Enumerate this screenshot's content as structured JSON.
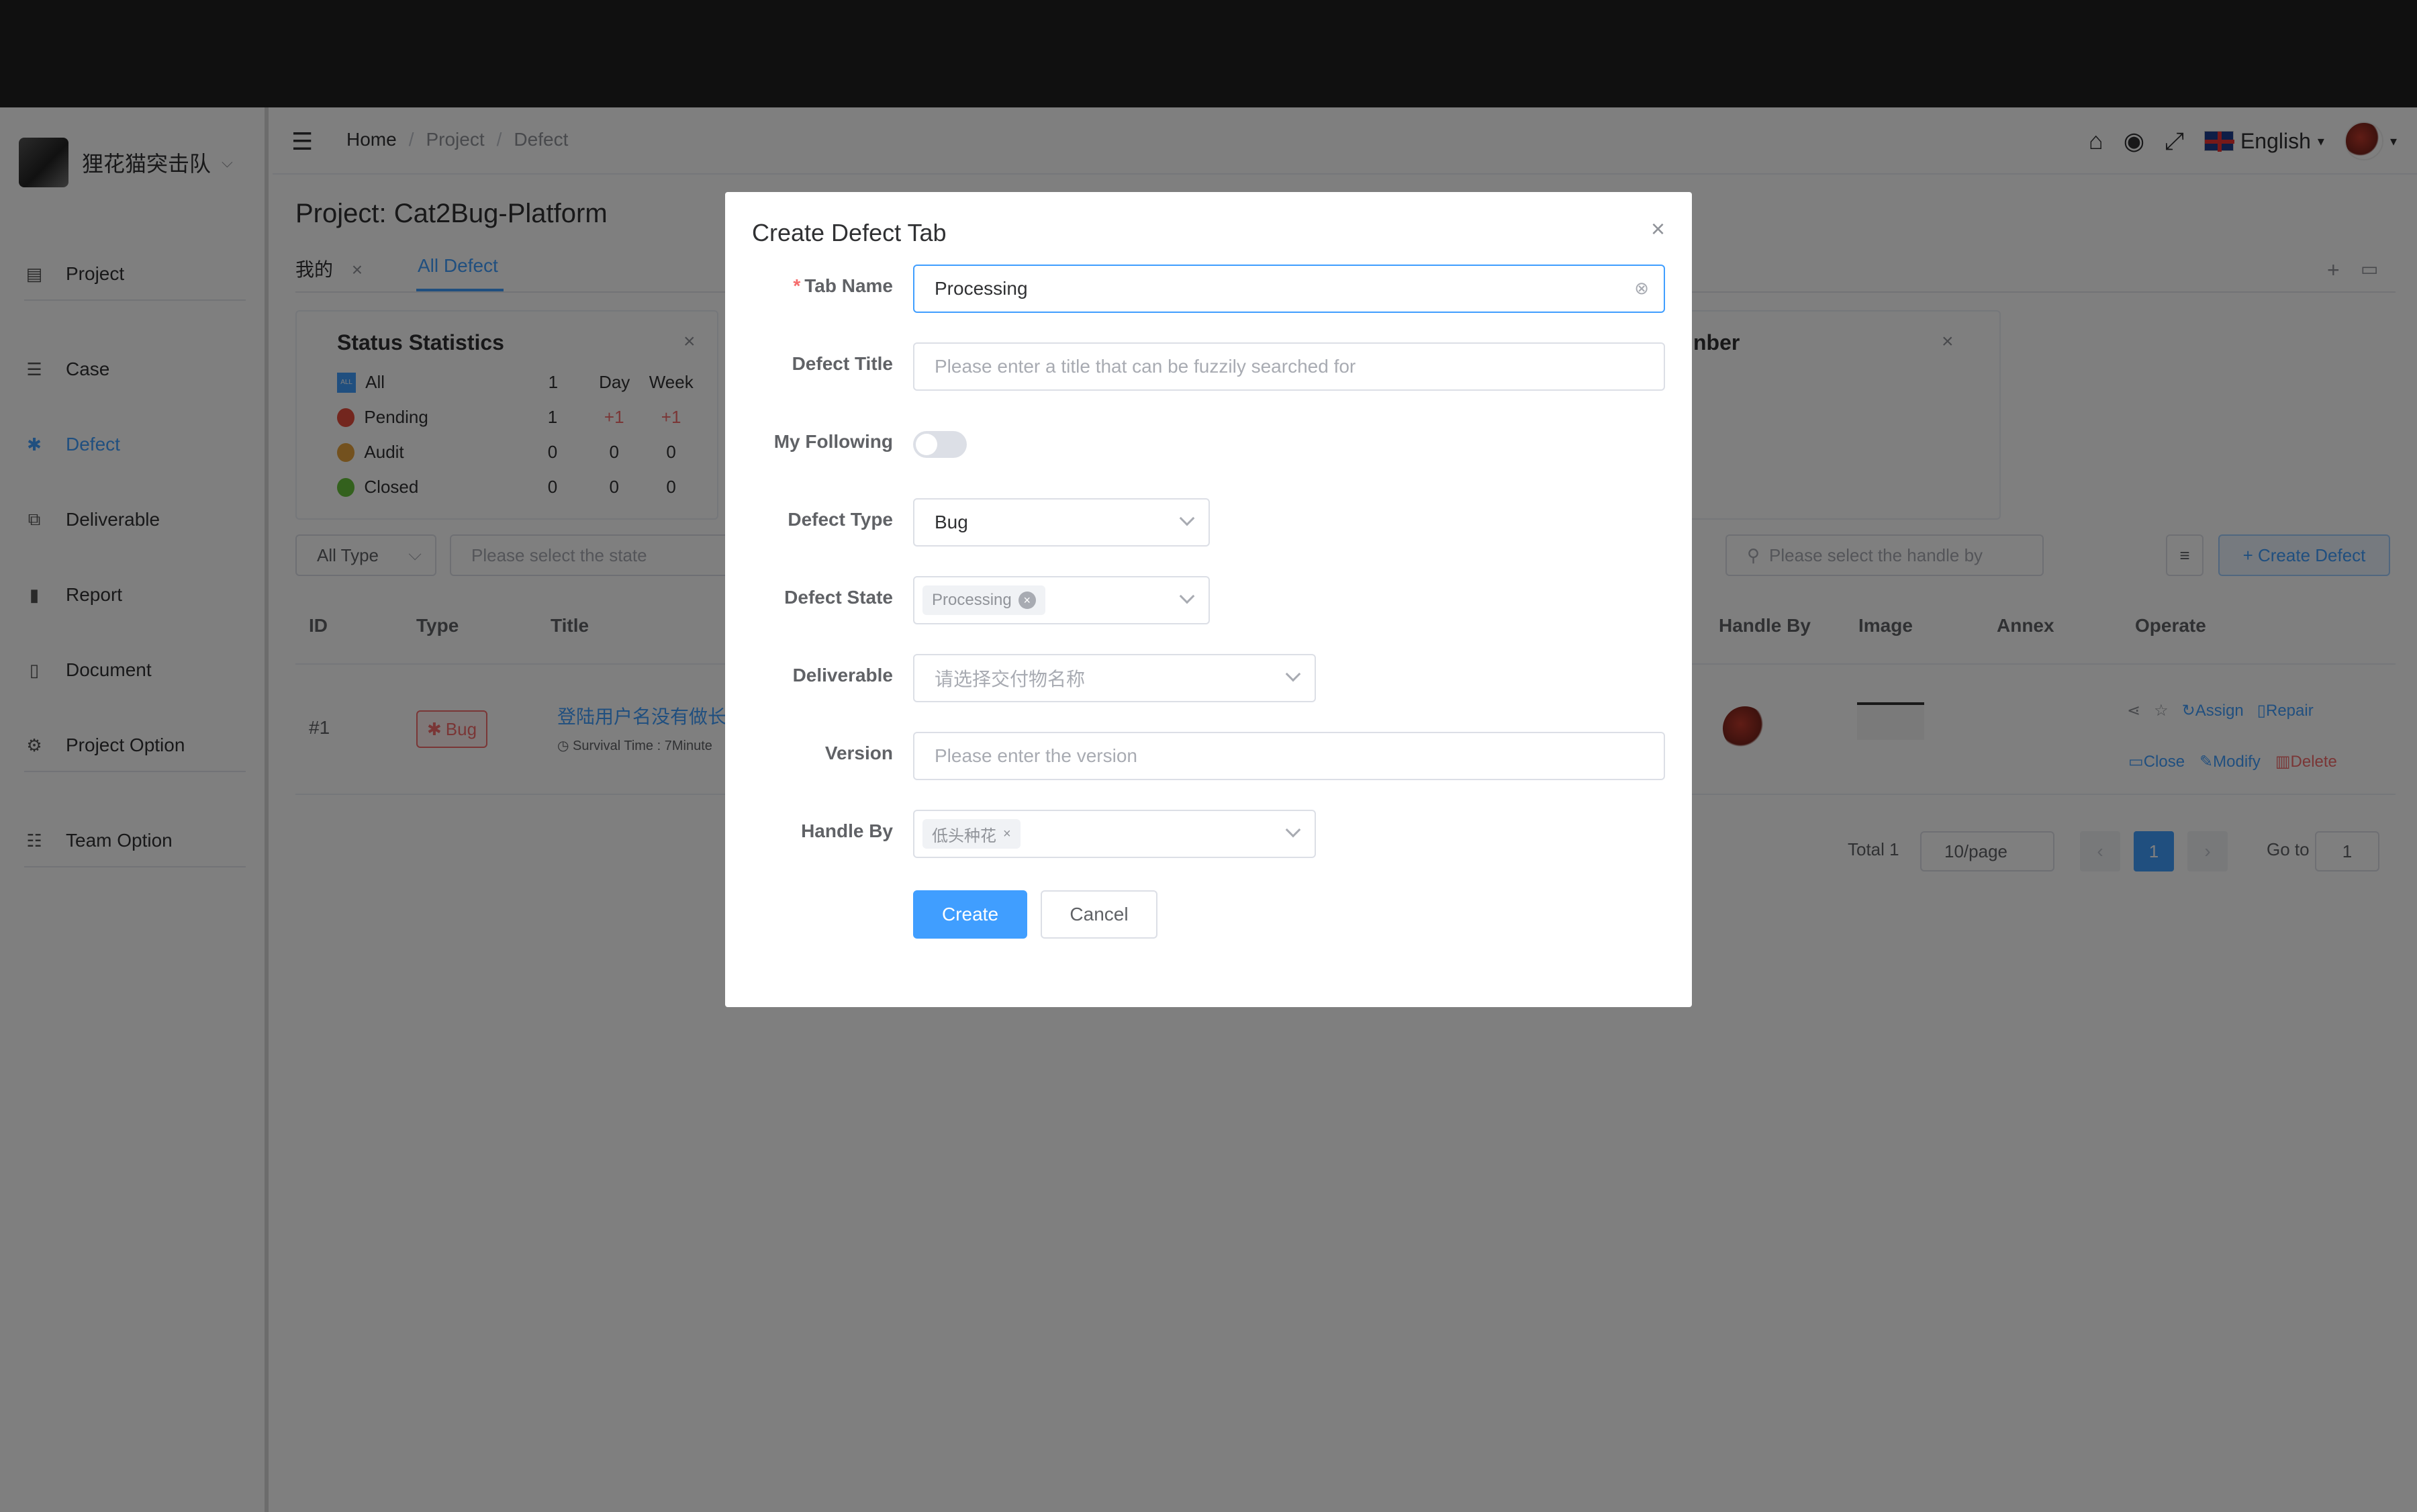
{
  "sidebar": {
    "team_name": "狸花猫突击队",
    "items": [
      {
        "label": "Project",
        "icon": "folder-icon"
      },
      {
        "label": "Case",
        "icon": "list-icon"
      },
      {
        "label": "Defect",
        "icon": "bug-icon"
      },
      {
        "label": "Deliverable",
        "icon": "package-icon"
      },
      {
        "label": "Report",
        "icon": "chart-icon"
      },
      {
        "label": "Document",
        "icon": "book-icon"
      },
      {
        "label": "Project Option",
        "icon": "gear-icon"
      },
      {
        "label": "Team Option",
        "icon": "team-icon"
      }
    ]
  },
  "header": {
    "breadcrumb": [
      "Home",
      "Project",
      "Defect"
    ],
    "language": "English"
  },
  "main": {
    "project_label": "Project:",
    "project_name": "Cat2Bug-Platform",
    "tabs": [
      "我的",
      "All Defect"
    ],
    "status_card": {
      "title": "Status Statistics",
      "columns": [
        "Day",
        "Week"
      ],
      "rows": [
        {
          "label": "All",
          "count": "1",
          "day": "",
          "week": ""
        },
        {
          "label": "Pending",
          "count": "1",
          "day": "+1",
          "week": "+1"
        },
        {
          "label": "Audit",
          "count": "0",
          "day": "0",
          "week": "0"
        },
        {
          "label": "Closed",
          "count": "0",
          "day": "0",
          "week": "0"
        }
      ],
      "all_badge": "ALL"
    },
    "member_card_title_fragment": "nber",
    "filters": {
      "type": "All Type",
      "state_placeholder": "Please select the state",
      "handle_placeholder": "Please select the handle by",
      "create_label": "+ Create Defect"
    },
    "table": {
      "headers": [
        "ID",
        "Type",
        "Title",
        "Handle By",
        "Image",
        "Annex",
        "Operate"
      ],
      "row": {
        "id": "#1",
        "type": "Bug",
        "title": "登陆用户名没有做长",
        "survival": "Survival Time :",
        "survival_value": "7Minute",
        "ops": [
          "Assign",
          "Repair",
          "Close",
          "Modify",
          "Delete"
        ]
      }
    },
    "pagination": {
      "total": "Total 1",
      "page_size": "10/page",
      "current": "1",
      "goto_label": "Go to",
      "goto_value": "1"
    }
  },
  "modal": {
    "title": "Create Defect Tab",
    "fields": {
      "tab_name": {
        "label": "Tab Name",
        "value": "Processing"
      },
      "defect_title": {
        "label": "Defect Title",
        "placeholder": "Please enter a title that can be fuzzily searched for"
      },
      "my_following": {
        "label": "My Following"
      },
      "defect_type": {
        "label": "Defect Type",
        "value": "Bug"
      },
      "defect_state": {
        "label": "Defect State",
        "chip": "Processing"
      },
      "deliverable": {
        "label": "Deliverable",
        "placeholder": "请选择交付物名称"
      },
      "version": {
        "label": "Version",
        "placeholder": "Please enter the version"
      },
      "handle_by": {
        "label": "Handle By",
        "chip": "低头种花"
      }
    },
    "create_label": "Create",
    "cancel_label": "Cancel"
  },
  "colors": {
    "primary": "#409eff",
    "danger": "#f56c6c",
    "topbar": "#212121"
  }
}
